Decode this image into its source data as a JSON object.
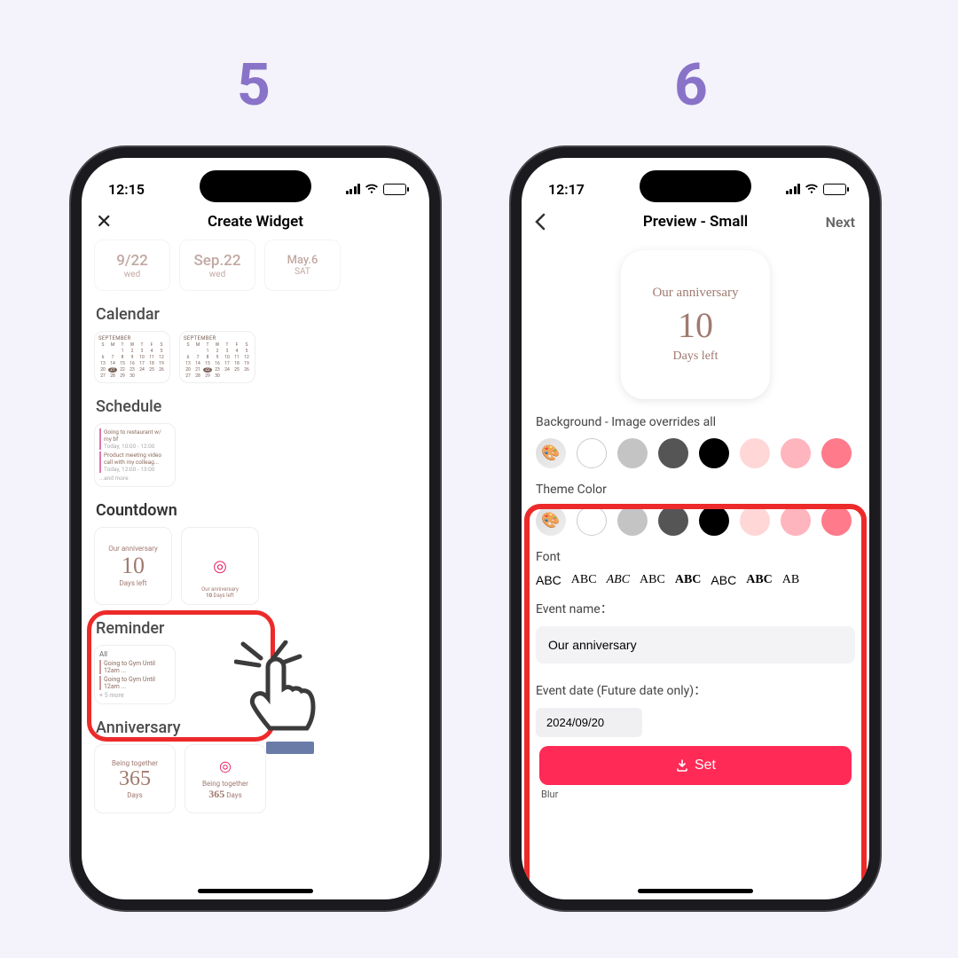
{
  "steps": {
    "five": "5",
    "six": "6"
  },
  "left": {
    "status_time": "12:15",
    "nav_title": "Create Widget",
    "date_cards": [
      {
        "line1": "9/22",
        "line2": "wed"
      },
      {
        "line1": "Sep.22",
        "line2": "wed"
      },
      {
        "line1": "May.6",
        "line2": "SAT"
      }
    ],
    "sections": {
      "calendar": "Calendar",
      "schedule": "Schedule",
      "countdown": "Countdown",
      "reminder": "Reminder",
      "anniversary": "Anniversary"
    },
    "calendar_month": "SEPTEMBER",
    "calendar_days": [
      "S",
      "M",
      "T",
      "W",
      "T",
      "F",
      "S"
    ],
    "schedule_items": [
      {
        "title": "Going to restaurant w/ my bf",
        "meta": "Today, 10:00 - 12:00"
      },
      {
        "title": "Product meeting video call with my colleag...",
        "meta": "Today, 12:00 - 13:00"
      },
      {
        "more": "...and more"
      }
    ],
    "countdown": {
      "title": "Our anniversary",
      "number": "10",
      "sub": "Days left",
      "tiny": "Our anniversary 10 Days left"
    },
    "reminder": {
      "head": "All",
      "items": [
        "Going to Gym Until 12am ...",
        "Going to Gym Until 12am ..."
      ],
      "more": "+ 5 more"
    },
    "anniversary": {
      "title": "Being together",
      "number": "365",
      "unit": "Days",
      "tiny": "Being together 365 Days"
    }
  },
  "right": {
    "status_time": "12:17",
    "nav_title": "Preview - Small",
    "nav_next": "Next",
    "preview": {
      "title": "Our anniversary",
      "number": "10",
      "sub": "Days left"
    },
    "labels": {
      "background": "Background - Image overrides all",
      "theme": "Theme Color",
      "font": "Font",
      "event_name": "Event name：",
      "event_date": "Event date (Future date only)：",
      "blur": "Blur"
    },
    "fonts": [
      "ABC",
      "ABC",
      "ABC",
      "ABC",
      "ABC",
      "ABC",
      "ABC",
      "AB"
    ],
    "event_name_value": "Our anniversary",
    "event_date_value": "2024/09/20",
    "set_button": "Set"
  }
}
